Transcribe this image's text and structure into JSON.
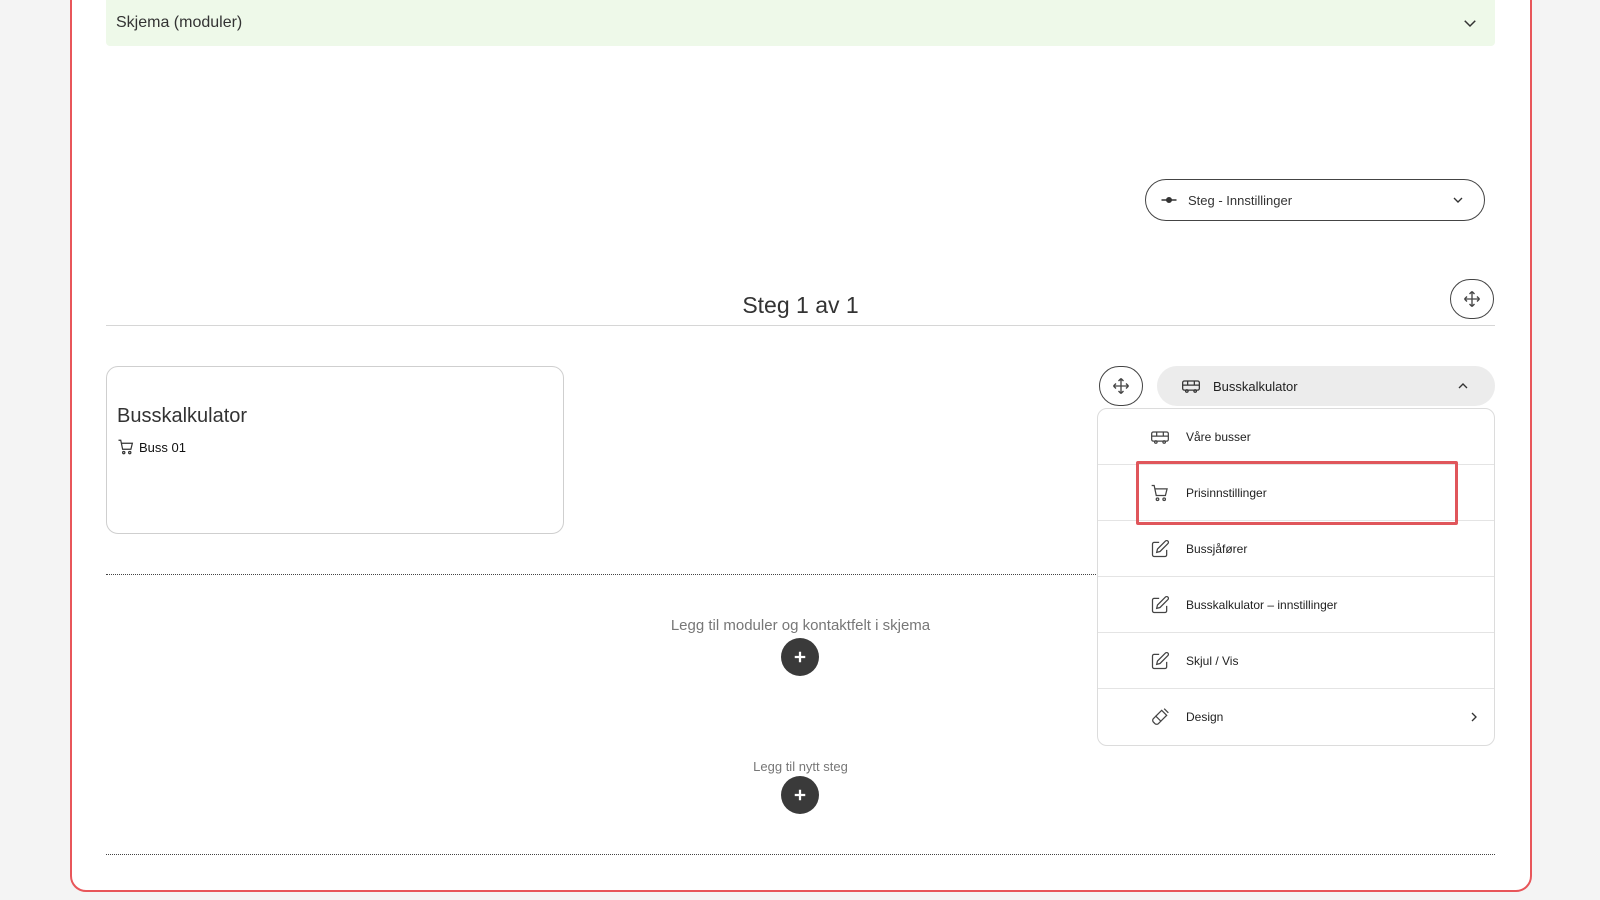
{
  "accordion": {
    "title": "Skjema (moduler)"
  },
  "step_settings": {
    "label": "Steg - Innstillinger"
  },
  "step_header": {
    "title": "Steg 1 av 1"
  },
  "card": {
    "title": "Busskalkulator",
    "item": "Buss 01"
  },
  "add_modules": {
    "label": "Legg til moduler og kontaktfelt i skjema"
  },
  "add_step": {
    "label": "Legg til nytt steg"
  },
  "module_menu": {
    "title": "Busskalkulator",
    "items": [
      {
        "label": "Våre busser",
        "icon": "bus-icon"
      },
      {
        "label": "Prisinnstillinger",
        "icon": "cart-icon"
      },
      {
        "label": "Bussjåfører",
        "icon": "edit-icon"
      },
      {
        "label": "Busskalkulator – innstillinger",
        "icon": "edit-icon"
      },
      {
        "label": "Skjul / Vis",
        "icon": "edit-icon"
      },
      {
        "label": "Design",
        "icon": "brush-icon"
      }
    ]
  },
  "colors": {
    "frame_border": "#e8565a",
    "accordion_bg": "#eef9e9",
    "highlight": "#e0565b",
    "plus_bg": "#3a3a3a"
  }
}
